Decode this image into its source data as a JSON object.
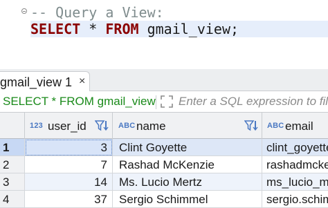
{
  "editor": {
    "comment_line": "-- Query a View:",
    "keyword_select": "SELECT",
    "star": " * ",
    "keyword_from": "FROM",
    "table_name": " gmail_view",
    "semicolon": ";"
  },
  "results_tab": {
    "label": "gmail_view 1",
    "close_icon": "×"
  },
  "filter_bar": {
    "query_text": "SELECT * FROM gmail_view",
    "placeholder": "Enter a SQL expression to filter results (use Ctrl+Space)"
  },
  "grid": {
    "columns": [
      {
        "type_badge": "123",
        "name": "user_id",
        "has_filter_icon": true
      },
      {
        "type_badge": "ABC",
        "name": "name",
        "has_filter_icon": true
      },
      {
        "type_badge": "ABC",
        "name": "email",
        "has_filter_icon": false
      }
    ],
    "rows": [
      {
        "num": "1",
        "user_id": "3",
        "name": "Clint Goyette",
        "email": "clint_goyette"
      },
      {
        "num": "2",
        "user_id": "7",
        "name": "Rashad McKenzie",
        "email": "rashadmckenzie"
      },
      {
        "num": "3",
        "user_id": "14",
        "name": "Ms. Lucio Mertz",
        "email": "ms_lucio_mertz"
      },
      {
        "num": "4",
        "user_id": "37",
        "name": "Sergio Schimmel",
        "email": "sergio.schimmel"
      }
    ],
    "selected_row": 0
  },
  "colors": {
    "keyword": "#8b0000",
    "comment": "#7f8c8d",
    "filter_query": "#1a8a1a",
    "type_badge": "#4a78c2",
    "selection": "#d8e4f8"
  }
}
